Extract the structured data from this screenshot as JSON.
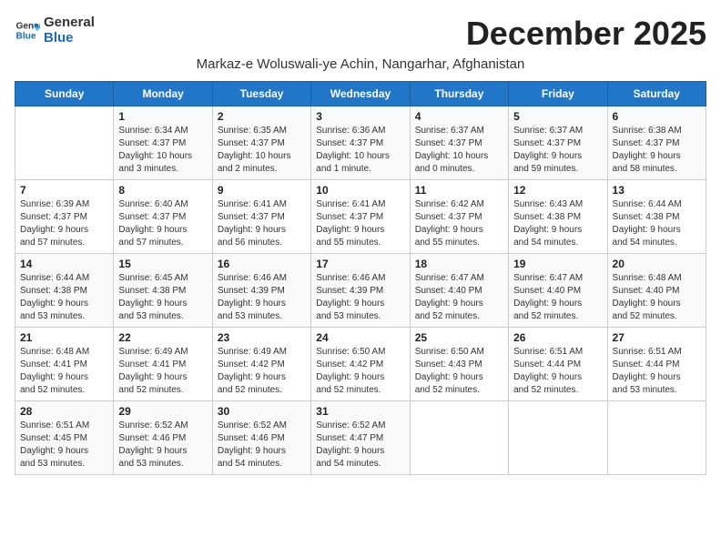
{
  "header": {
    "logo_line1": "General",
    "logo_line2": "Blue",
    "month_title": "December 2025",
    "subtitle": "Markaz-e Woluswali-ye Achin, Nangarhar, Afghanistan"
  },
  "weekdays": [
    "Sunday",
    "Monday",
    "Tuesday",
    "Wednesday",
    "Thursday",
    "Friday",
    "Saturday"
  ],
  "weeks": [
    [
      {
        "day": "",
        "info": ""
      },
      {
        "day": "1",
        "info": "Sunrise: 6:34 AM\nSunset: 4:37 PM\nDaylight: 10 hours\nand 3 minutes."
      },
      {
        "day": "2",
        "info": "Sunrise: 6:35 AM\nSunset: 4:37 PM\nDaylight: 10 hours\nand 2 minutes."
      },
      {
        "day": "3",
        "info": "Sunrise: 6:36 AM\nSunset: 4:37 PM\nDaylight: 10 hours\nand 1 minute."
      },
      {
        "day": "4",
        "info": "Sunrise: 6:37 AM\nSunset: 4:37 PM\nDaylight: 10 hours\nand 0 minutes."
      },
      {
        "day": "5",
        "info": "Sunrise: 6:37 AM\nSunset: 4:37 PM\nDaylight: 9 hours\nand 59 minutes."
      },
      {
        "day": "6",
        "info": "Sunrise: 6:38 AM\nSunset: 4:37 PM\nDaylight: 9 hours\nand 58 minutes."
      }
    ],
    [
      {
        "day": "7",
        "info": "Sunrise: 6:39 AM\nSunset: 4:37 PM\nDaylight: 9 hours\nand 57 minutes."
      },
      {
        "day": "8",
        "info": "Sunrise: 6:40 AM\nSunset: 4:37 PM\nDaylight: 9 hours\nand 57 minutes."
      },
      {
        "day": "9",
        "info": "Sunrise: 6:41 AM\nSunset: 4:37 PM\nDaylight: 9 hours\nand 56 minutes."
      },
      {
        "day": "10",
        "info": "Sunrise: 6:41 AM\nSunset: 4:37 PM\nDaylight: 9 hours\nand 55 minutes."
      },
      {
        "day": "11",
        "info": "Sunrise: 6:42 AM\nSunset: 4:37 PM\nDaylight: 9 hours\nand 55 minutes."
      },
      {
        "day": "12",
        "info": "Sunrise: 6:43 AM\nSunset: 4:38 PM\nDaylight: 9 hours\nand 54 minutes."
      },
      {
        "day": "13",
        "info": "Sunrise: 6:44 AM\nSunset: 4:38 PM\nDaylight: 9 hours\nand 54 minutes."
      }
    ],
    [
      {
        "day": "14",
        "info": "Sunrise: 6:44 AM\nSunset: 4:38 PM\nDaylight: 9 hours\nand 53 minutes."
      },
      {
        "day": "15",
        "info": "Sunrise: 6:45 AM\nSunset: 4:38 PM\nDaylight: 9 hours\nand 53 minutes."
      },
      {
        "day": "16",
        "info": "Sunrise: 6:46 AM\nSunset: 4:39 PM\nDaylight: 9 hours\nand 53 minutes."
      },
      {
        "day": "17",
        "info": "Sunrise: 6:46 AM\nSunset: 4:39 PM\nDaylight: 9 hours\nand 53 minutes."
      },
      {
        "day": "18",
        "info": "Sunrise: 6:47 AM\nSunset: 4:40 PM\nDaylight: 9 hours\nand 52 minutes."
      },
      {
        "day": "19",
        "info": "Sunrise: 6:47 AM\nSunset: 4:40 PM\nDaylight: 9 hours\nand 52 minutes."
      },
      {
        "day": "20",
        "info": "Sunrise: 6:48 AM\nSunset: 4:40 PM\nDaylight: 9 hours\nand 52 minutes."
      }
    ],
    [
      {
        "day": "21",
        "info": "Sunrise: 6:48 AM\nSunset: 4:41 PM\nDaylight: 9 hours\nand 52 minutes."
      },
      {
        "day": "22",
        "info": "Sunrise: 6:49 AM\nSunset: 4:41 PM\nDaylight: 9 hours\nand 52 minutes."
      },
      {
        "day": "23",
        "info": "Sunrise: 6:49 AM\nSunset: 4:42 PM\nDaylight: 9 hours\nand 52 minutes."
      },
      {
        "day": "24",
        "info": "Sunrise: 6:50 AM\nSunset: 4:42 PM\nDaylight: 9 hours\nand 52 minutes."
      },
      {
        "day": "25",
        "info": "Sunrise: 6:50 AM\nSunset: 4:43 PM\nDaylight: 9 hours\nand 52 minutes."
      },
      {
        "day": "26",
        "info": "Sunrise: 6:51 AM\nSunset: 4:44 PM\nDaylight: 9 hours\nand 52 minutes."
      },
      {
        "day": "27",
        "info": "Sunrise: 6:51 AM\nSunset: 4:44 PM\nDaylight: 9 hours\nand 53 minutes."
      }
    ],
    [
      {
        "day": "28",
        "info": "Sunrise: 6:51 AM\nSunset: 4:45 PM\nDaylight: 9 hours\nand 53 minutes."
      },
      {
        "day": "29",
        "info": "Sunrise: 6:52 AM\nSunset: 4:46 PM\nDaylight: 9 hours\nand 53 minutes."
      },
      {
        "day": "30",
        "info": "Sunrise: 6:52 AM\nSunset: 4:46 PM\nDaylight: 9 hours\nand 54 minutes."
      },
      {
        "day": "31",
        "info": "Sunrise: 6:52 AM\nSunset: 4:47 PM\nDaylight: 9 hours\nand 54 minutes."
      },
      {
        "day": "",
        "info": ""
      },
      {
        "day": "",
        "info": ""
      },
      {
        "day": "",
        "info": ""
      }
    ]
  ]
}
